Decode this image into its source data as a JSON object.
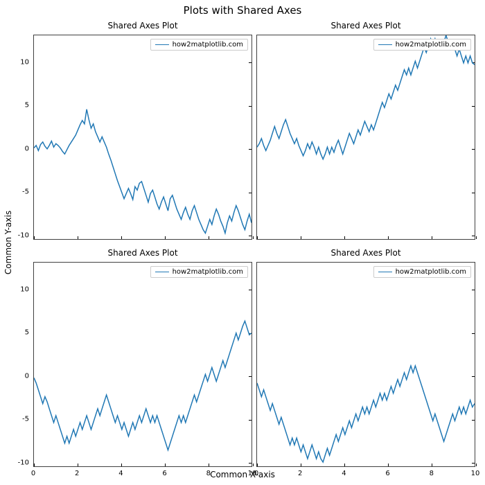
{
  "suptitle": "Plots with Shared Axes",
  "ylabel": "Common Y-axis",
  "xlabel": "Common X-axis",
  "legend_label": "how2matplotlib.com",
  "subplot_title": "Shared Axes Plot",
  "xlim": [
    0,
    10
  ],
  "ylim": [
    -10.5,
    13.2
  ],
  "xticks": [
    0,
    2,
    4,
    6,
    8,
    10
  ],
  "yticks": [
    -10,
    -5,
    0,
    5,
    10
  ],
  "chart_data": [
    {
      "type": "line",
      "title": "Shared Axes Plot",
      "xlim": [
        0,
        10
      ],
      "ylim": [
        -10.5,
        13.2
      ],
      "n": 100,
      "x_start": 0,
      "x_end": 10,
      "y": [
        0.1,
        0.4,
        -0.2,
        0.5,
        0.8,
        0.3,
        0.0,
        0.4,
        0.9,
        0.2,
        0.6,
        0.4,
        0.1,
        -0.3,
        -0.6,
        -0.1,
        0.4,
        0.8,
        1.2,
        1.6,
        2.2,
        2.8,
        3.3,
        2.9,
        4.6,
        3.4,
        2.4,
        2.9,
        2.0,
        1.4,
        0.8,
        1.4,
        0.8,
        0.2,
        -0.6,
        -1.3,
        -2.1,
        -2.9,
        -3.7,
        -4.4,
        -5.1,
        -5.8,
        -5.2,
        -4.6,
        -5.2,
        -5.9,
        -4.4,
        -4.8,
        -4.0,
        -3.8,
        -4.6,
        -5.4,
        -6.2,
        -5.2,
        -4.8,
        -5.6,
        -6.4,
        -7.0,
        -6.2,
        -5.6,
        -6.4,
        -7.2,
        -5.8,
        -5.4,
        -6.2,
        -7.0,
        -7.6,
        -8.2,
        -7.4,
        -6.8,
        -7.6,
        -8.2,
        -7.2,
        -6.6,
        -7.4,
        -8.2,
        -8.8,
        -9.4,
        -9.8,
        -9.0,
        -8.2,
        -8.8,
        -7.8,
        -7.0,
        -7.6,
        -8.4,
        -9.0,
        -9.8,
        -8.6,
        -7.8,
        -8.4,
        -7.4,
        -6.6,
        -7.2,
        -8.0,
        -8.8,
        -9.4,
        -8.4,
        -7.6,
        -8.6
      ]
    },
    {
      "type": "line",
      "title": "Shared Axes Plot",
      "xlim": [
        0,
        10
      ],
      "ylim": [
        -10.5,
        13.2
      ],
      "n": 100,
      "x_start": 0,
      "x_end": 10,
      "y": [
        0.2,
        0.6,
        1.2,
        0.4,
        -0.2,
        0.4,
        1.0,
        1.8,
        2.6,
        1.8,
        1.2,
        2.0,
        2.8,
        3.4,
        2.6,
        1.8,
        1.2,
        0.6,
        1.2,
        0.4,
        -0.2,
        -0.8,
        -0.2,
        0.6,
        0.0,
        0.8,
        0.2,
        -0.6,
        0.2,
        -0.6,
        -1.2,
        -0.6,
        0.2,
        -0.6,
        0.2,
        -0.4,
        0.4,
        1.0,
        0.2,
        -0.6,
        0.2,
        1.0,
        1.8,
        1.2,
        0.6,
        1.4,
        2.2,
        1.6,
        2.4,
        3.2,
        2.6,
        2.0,
        2.8,
        2.2,
        3.0,
        3.8,
        4.6,
        5.4,
        4.8,
        5.6,
        6.4,
        5.8,
        6.6,
        7.4,
        6.8,
        7.6,
        8.4,
        9.2,
        8.6,
        9.4,
        8.6,
        9.4,
        10.2,
        9.4,
        10.2,
        11.0,
        11.8,
        11.2,
        12.0,
        12.8,
        12.0,
        12.8,
        11.8,
        12.6,
        11.8,
        12.4,
        13.2,
        12.4,
        11.6,
        12.4,
        11.6,
        10.8,
        11.6,
        10.8,
        10.0,
        10.8,
        10.0,
        10.8,
        10.0,
        9.8
      ]
    },
    {
      "type": "line",
      "title": "Shared Axes Plot",
      "xlim": [
        0,
        10
      ],
      "ylim": [
        -10.5,
        13.2
      ],
      "n": 100,
      "x_start": 0,
      "x_end": 10,
      "y": [
        -0.2,
        -0.8,
        -1.6,
        -2.4,
        -3.2,
        -2.4,
        -3.0,
        -3.8,
        -4.6,
        -5.4,
        -4.6,
        -5.4,
        -6.2,
        -7.0,
        -7.8,
        -7.0,
        -7.8,
        -7.0,
        -6.2,
        -7.0,
        -6.2,
        -5.4,
        -6.2,
        -5.4,
        -4.6,
        -5.4,
        -6.2,
        -5.4,
        -4.6,
        -3.8,
        -4.6,
        -3.8,
        -3.0,
        -2.2,
        -3.0,
        -3.8,
        -4.6,
        -5.4,
        -4.6,
        -5.4,
        -6.2,
        -5.4,
        -6.2,
        -7.0,
        -6.2,
        -5.4,
        -6.2,
        -5.4,
        -4.6,
        -5.4,
        -4.6,
        -3.8,
        -4.6,
        -5.4,
        -4.6,
        -5.4,
        -4.6,
        -5.4,
        -6.2,
        -7.0,
        -7.8,
        -8.6,
        -7.8,
        -7.0,
        -6.2,
        -5.4,
        -4.6,
        -5.4,
        -4.6,
        -5.4,
        -4.6,
        -3.8,
        -3.0,
        -2.2,
        -3.0,
        -2.2,
        -1.4,
        -0.6,
        0.2,
        -0.6,
        0.2,
        1.0,
        0.2,
        -0.6,
        0.2,
        1.0,
        1.8,
        1.0,
        1.8,
        2.6,
        3.4,
        4.2,
        5.0,
        4.2,
        5.0,
        5.8,
        6.4,
        5.6,
        4.8,
        5.0
      ]
    },
    {
      "type": "line",
      "title": "Shared Axes Plot",
      "xlim": [
        0,
        10
      ],
      "ylim": [
        -10.5,
        13.2
      ],
      "n": 100,
      "x_start": 0,
      "x_end": 10,
      "y": [
        -0.8,
        -1.6,
        -2.4,
        -1.6,
        -2.4,
        -3.2,
        -4.0,
        -3.2,
        -4.0,
        -4.8,
        -5.6,
        -4.8,
        -5.6,
        -6.4,
        -7.2,
        -8.0,
        -7.2,
        -8.0,
        -7.2,
        -8.0,
        -8.8,
        -8.0,
        -8.8,
        -9.6,
        -8.8,
        -8.0,
        -8.8,
        -9.6,
        -8.8,
        -9.6,
        -10.0,
        -9.2,
        -8.4,
        -9.2,
        -8.4,
        -7.6,
        -6.8,
        -7.6,
        -6.8,
        -6.0,
        -6.8,
        -6.0,
        -5.2,
        -6.0,
        -5.2,
        -4.4,
        -5.2,
        -4.4,
        -3.6,
        -4.4,
        -3.6,
        -4.4,
        -3.6,
        -2.8,
        -3.6,
        -2.8,
        -2.0,
        -2.8,
        -2.0,
        -2.8,
        -2.0,
        -1.2,
        -2.0,
        -1.2,
        -0.4,
        -1.2,
        -0.4,
        0.4,
        -0.4,
        0.4,
        1.2,
        0.4,
        1.2,
        0.4,
        -0.4,
        -1.2,
        -2.0,
        -2.8,
        -3.6,
        -4.4,
        -5.2,
        -4.4,
        -5.2,
        -6.0,
        -6.8,
        -7.6,
        -6.8,
        -6.0,
        -5.2,
        -4.4,
        -5.2,
        -4.4,
        -3.6,
        -4.4,
        -3.6,
        -4.4,
        -3.6,
        -2.8,
        -3.6,
        -3.2
      ]
    }
  ]
}
